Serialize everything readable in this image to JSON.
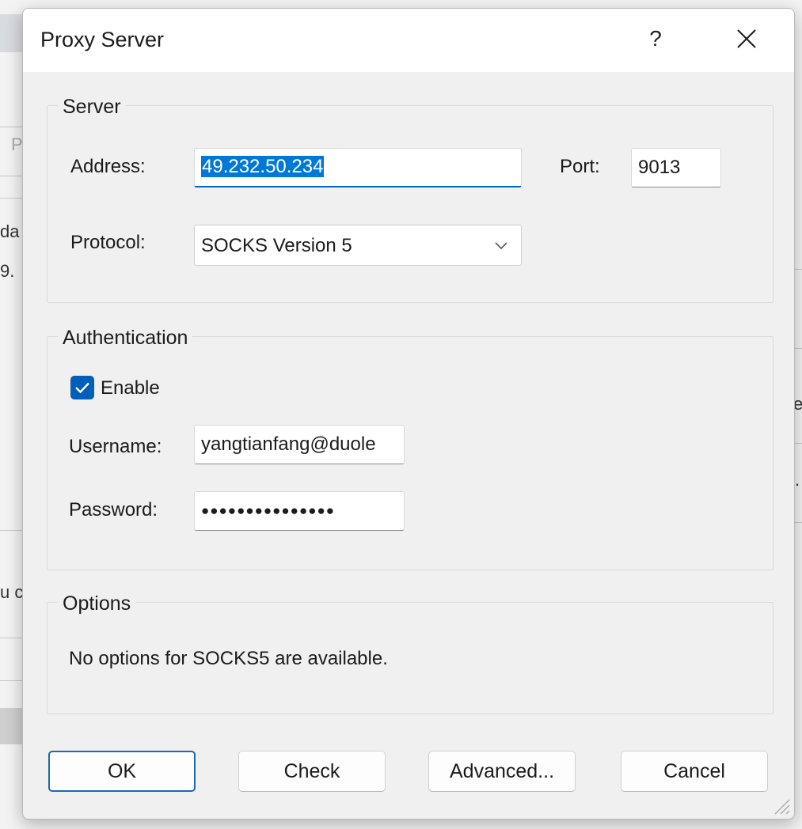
{
  "window": {
    "title": "Proxy Server",
    "help_label": "?",
    "close_icon": "close-icon"
  },
  "background": {
    "fragments": [
      "P",
      "da",
      "9.",
      "e",
      "u c",
      "."
    ]
  },
  "server": {
    "legend": "Server",
    "address_label": "Address:",
    "address_value": "49.232.50.234",
    "port_label": "Port:",
    "port_value": "9013",
    "protocol_label": "Protocol:",
    "protocol_value": "SOCKS Version 5"
  },
  "auth": {
    "legend": "Authentication",
    "enable_label": "Enable",
    "enable_checked": true,
    "username_label": "Username:",
    "username_value": "yangtianfang@duole",
    "password_label": "Password:",
    "password_value": "●●●●●●●●●●●●●●●"
  },
  "options": {
    "legend": "Options",
    "message": "No options for SOCKS5 are available."
  },
  "buttons": {
    "ok": "OK",
    "check": "Check",
    "advanced": "Advanced...",
    "cancel": "Cancel"
  },
  "colors": {
    "accent": "#005fb8",
    "selection": "#0078d7",
    "default_button_border": "#1f67b3"
  }
}
